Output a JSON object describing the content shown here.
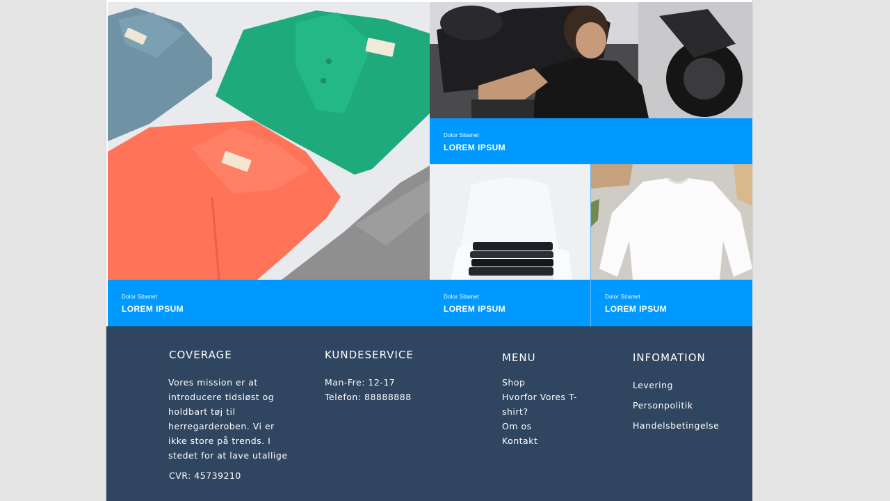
{
  "tiles": [
    {
      "subtitle": "Dolor Sitamet",
      "title": "LOREM IPSUM"
    },
    {
      "subtitle": "Dolor Sitamet",
      "title": "LOREM IPSUM"
    },
    {
      "subtitle": "Dolor Sitamet",
      "title": "LOREM IPSUM"
    },
    {
      "subtitle": "Dolor Sitamet",
      "title": "LOREM IPSUM"
    }
  ],
  "footer": {
    "coverage": {
      "heading": "COVERAGE",
      "text": "Vores mission er at introducere tidsløst og holdbart tøj til herregarderoben. Vi er ikke store på trends. I stedet for at lave utallige",
      "cvr": "CVR: 45739210"
    },
    "kundeservice": {
      "heading": "KUNDESERVICE",
      "hours": "Man-Fre: 12-17",
      "phone": "Telefon: 88888888"
    },
    "menu": {
      "heading": "MENU",
      "items": [
        "Shop",
        "Hvorfor Vores T-shirt?",
        "Om os",
        "Kontakt"
      ]
    },
    "information": {
      "heading": "INFOMATION",
      "items": [
        "Levering",
        "Personpolitik",
        "Handelsbetingelse"
      ]
    }
  },
  "colors": {
    "accent": "#0099ff",
    "footer_bg": "#2f4560",
    "page_bg": "#e4e4e4"
  }
}
